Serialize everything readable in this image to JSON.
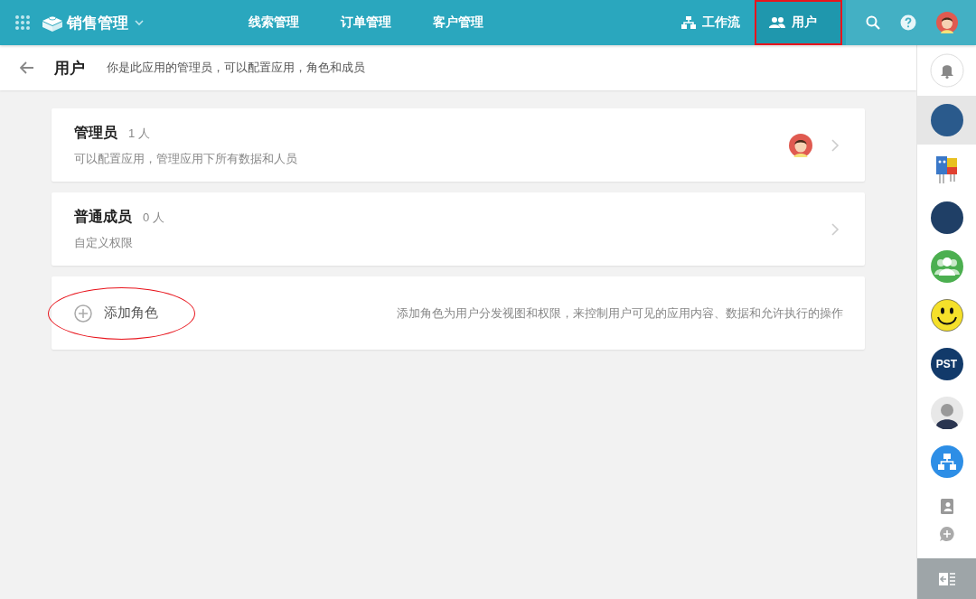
{
  "app": {
    "title": "销售管理"
  },
  "nav": [
    {
      "label": "线索管理",
      "selected": false
    },
    {
      "label": "订单管理",
      "selected": false
    },
    {
      "label": "客户管理",
      "selected": false
    }
  ],
  "header_links": [
    {
      "kind": "workflow",
      "label": "工作流",
      "selected": false,
      "annotated": false
    },
    {
      "kind": "users",
      "label": "用户",
      "selected": true,
      "annotated": true
    }
  ],
  "page": {
    "title": "用户",
    "description": "你是此应用的管理员，可以配置应用，角色和成员"
  },
  "roles": [
    {
      "name": "管理员",
      "count": "1 人",
      "description": "可以配置应用，管理应用下所有数据和人员",
      "has_avatar": true
    },
    {
      "name": "普通成员",
      "count": "0 人",
      "description": "自定义权限",
      "has_avatar": false
    }
  ],
  "add_role": {
    "label": "添加角色",
    "hint": "添加角色为用户分发视图和权限，来控制用户可见的应用内容、数据和允许执行的操作",
    "annotated": true
  },
  "sidebar_apps": [
    {
      "kind": "picture",
      "color": "#2a5a8c",
      "selected": true
    },
    {
      "kind": "robot",
      "color": "#3a78c8",
      "selected": false
    },
    {
      "kind": "picture",
      "color": "#1f3f66",
      "selected": false
    },
    {
      "kind": "group",
      "color": "#4caf50",
      "selected": false
    },
    {
      "kind": "smiley",
      "color": "#f5e02a",
      "selected": false
    },
    {
      "kind": "label",
      "label": "PST",
      "color": "#123a6a",
      "selected": false
    },
    {
      "kind": "person",
      "color": "#e8e8e8",
      "selected": false
    },
    {
      "kind": "org",
      "color": "#2d8ee6",
      "selected": false
    }
  ]
}
